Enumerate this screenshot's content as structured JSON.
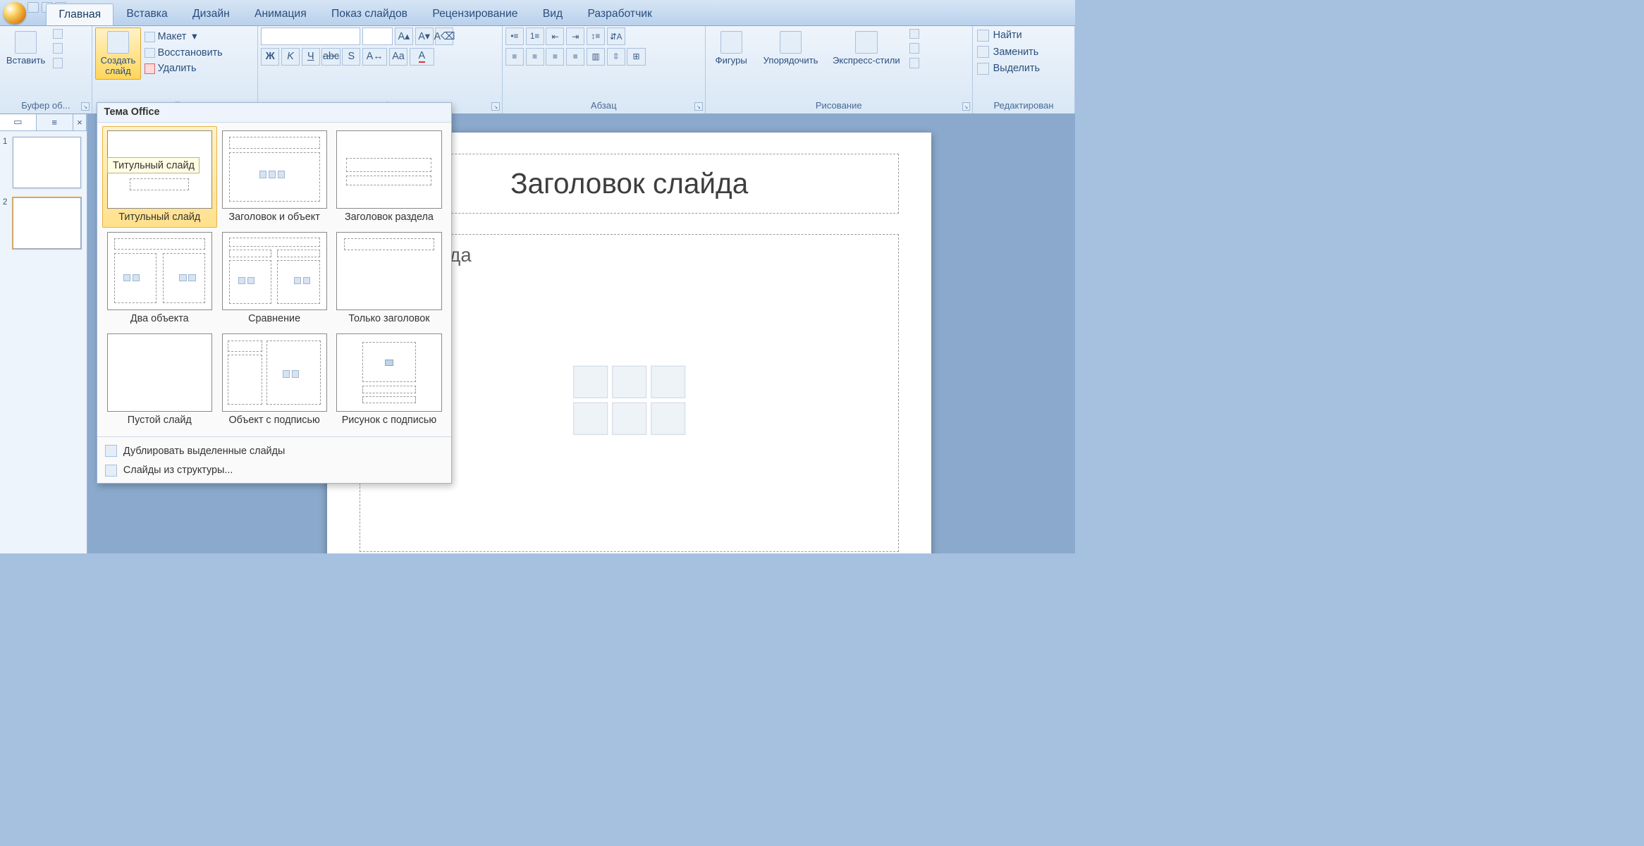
{
  "tabs": [
    "Главная",
    "Вставка",
    "Дизайн",
    "Анимация",
    "Показ слайдов",
    "Рецензирование",
    "Вид",
    "Разработчик"
  ],
  "active_tab": 0,
  "ribbon": {
    "clipboard": {
      "title": "Буфер об...",
      "paste": "Вставить"
    },
    "slides": {
      "title": "Слайды",
      "new": "Создать\nслайд",
      "layout": "Макет",
      "reset": "Восстановить",
      "delete": "Удалить"
    },
    "font": {
      "title": "Шрифт"
    },
    "paragraph": {
      "title": "Абзац"
    },
    "drawing": {
      "title": "Рисование",
      "shapes": "Фигуры",
      "arrange": "Упорядочить",
      "styles": "Экспресс-стили"
    },
    "editing": {
      "title": "Редактирован",
      "find": "Найти",
      "replace": "Заменить",
      "select": "Выделить"
    }
  },
  "gallery": {
    "header": "Тема Office",
    "tooltip": "Титульный слайд",
    "items": [
      "Титульный слайд",
      "Заголовок и объект",
      "Заголовок раздела",
      "Два объекта",
      "Сравнение",
      "Только заголовок",
      "Пустой слайд",
      "Объект с подписью",
      "Рисунок с подписью"
    ],
    "menu": [
      "Дублировать выделенные слайды",
      "Слайды из структуры..."
    ]
  },
  "thumbs": {
    "count": 2,
    "selected": 2
  },
  "slide": {
    "title_placeholder": "Заголовок слайда",
    "body_placeholder_visible": "кст слайда"
  }
}
